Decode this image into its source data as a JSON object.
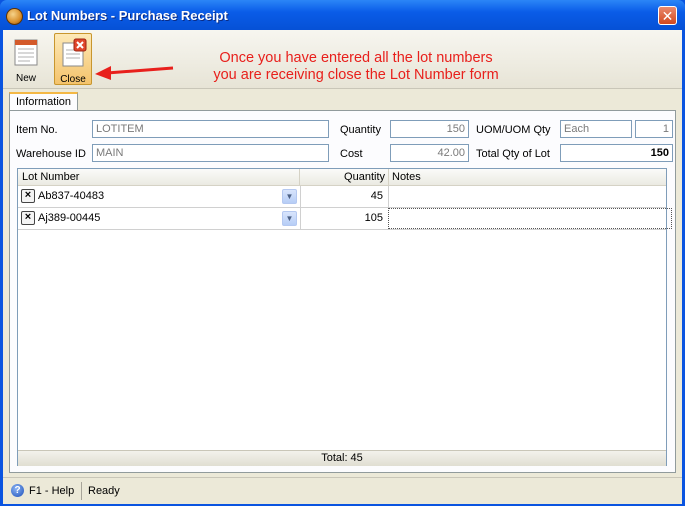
{
  "window": {
    "title": "Lot Numbers - Purchase Receipt",
    "close_glyph": "✕"
  },
  "toolbar": {
    "new_label": "New",
    "close_label": "Close"
  },
  "annotation": {
    "line1": "Once you have entered all the lot numbers",
    "line2": "you are receiving close the Lot Number form",
    "color": "#e8201c"
  },
  "tabs": [
    {
      "label": "Information"
    }
  ],
  "form": {
    "item_no_label": "Item No.",
    "item_no_value": "LOTITEM",
    "warehouse_label": "Warehouse ID",
    "warehouse_value": "MAIN",
    "quantity_label": "Quantity",
    "quantity_value": "150",
    "cost_label": "Cost",
    "cost_value": "42.00",
    "uom_label": "UOM/UOM Qty",
    "uom_value": "Each",
    "uom_qty_value": "1",
    "total_qty_label": "Total Qty of Lot",
    "total_qty_value": "150"
  },
  "grid": {
    "columns": [
      "Lot Number",
      "Quantity",
      "Notes"
    ],
    "rows": [
      {
        "lot": "Ab837-40483",
        "quantity": "45",
        "notes": ""
      },
      {
        "lot": "Aj389-00445",
        "quantity": "105",
        "notes": ""
      }
    ],
    "footer": "Total: 45"
  },
  "status": {
    "help": "F1 - Help",
    "state": "Ready"
  }
}
